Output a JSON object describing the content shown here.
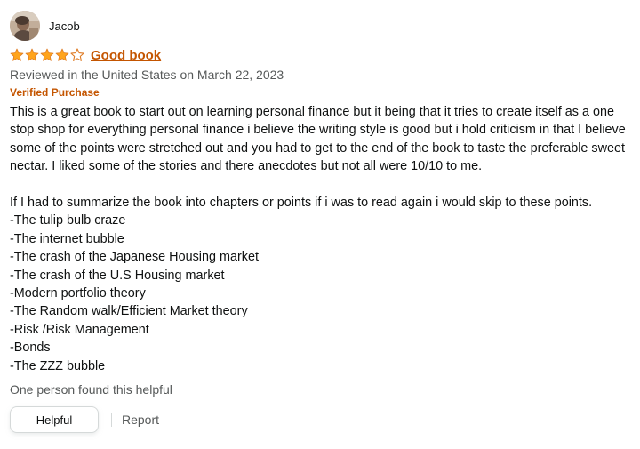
{
  "reviewer": {
    "name": "Jacob",
    "avatar_icon": "reviewer-avatar-photo"
  },
  "rating": {
    "value": 4,
    "max": 5,
    "star_color": "#ffa41c",
    "star_empty_color": "#de7921"
  },
  "review": {
    "title": "Good book",
    "date_text": "Reviewed in the United States on March 22, 2023",
    "verified_text": "Verified Purchase",
    "paragraph_1": "This is a great book to start out on learning personal finance but it being that it tries to create itself as a one stop shop for everything personal finance i believe the writing style is good but i hold criticism in that I believe some of the points were stretched out and you had to get to the end of the book to taste the preferable sweet nectar. I liked some of the stories and there anecdotes but not all were 10/10 to me.",
    "paragraph_2": "If I had to summarize the book into chapters or points if i was to read again i would skip to these points.",
    "points": [
      "-The tulip bulb craze",
      "-The internet bubble",
      "-The crash of the Japanese Housing market",
      "-The crash of the U.S Housing market",
      "-Modern portfolio theory",
      "-The Random walk/Efficient Market theory",
      "-Risk /Risk Management",
      "-Bonds",
      "-The ZZZ bubble"
    ]
  },
  "feedback": {
    "helpful_count_text": "One person found this helpful",
    "helpful_button_label": "Helpful",
    "report_label": "Report"
  },
  "colors": {
    "title_link": "#c45500",
    "secondary_text": "#565959",
    "body_text": "#0f1111"
  }
}
